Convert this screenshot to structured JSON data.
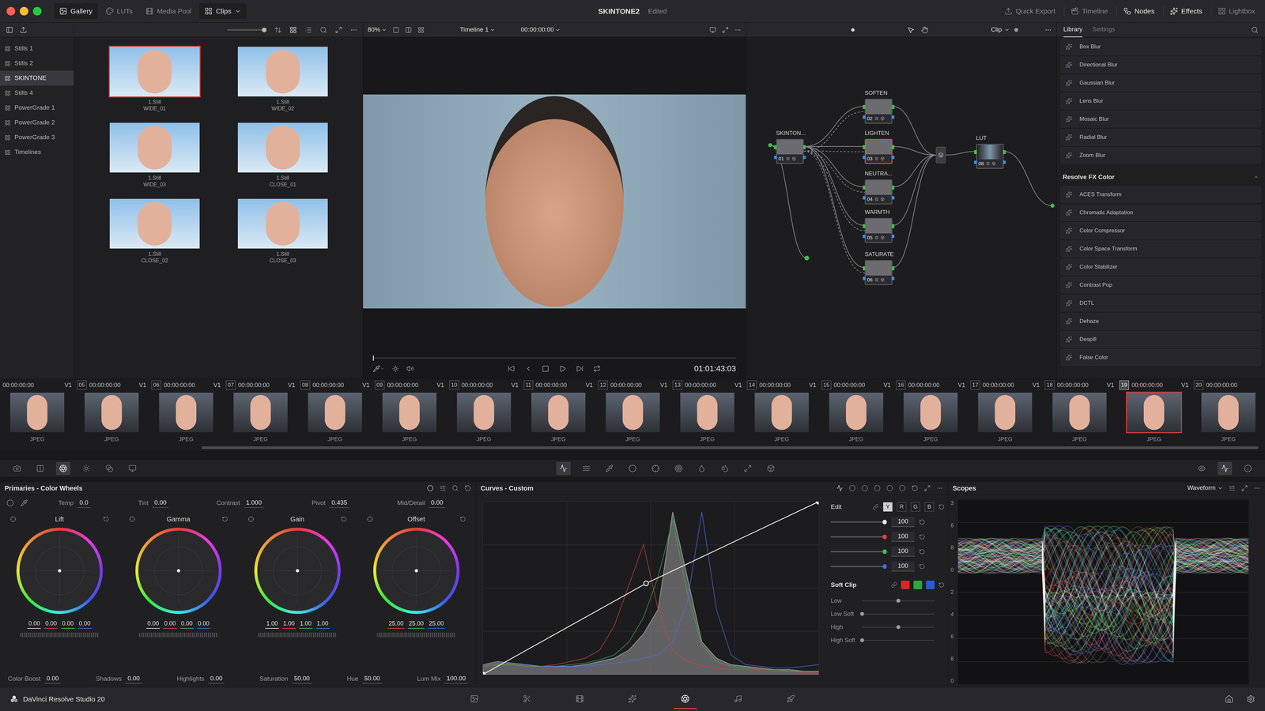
{
  "window": {
    "title": "SKINTONE2",
    "status": "Edited"
  },
  "top_left_tabs": [
    {
      "label": "Gallery",
      "selected": true
    },
    {
      "label": "LUTs",
      "selected": false
    },
    {
      "label": "Media Pool",
      "selected": false
    },
    {
      "label": "Clips",
      "selected": true
    }
  ],
  "top_right_tabs": [
    {
      "label": "Quick Export",
      "selected": false
    },
    {
      "label": "Timeline",
      "selected": false
    },
    {
      "label": "Nodes",
      "selected": true
    },
    {
      "label": "Effects",
      "selected": true
    },
    {
      "label": "Lightbox",
      "selected": false
    }
  ],
  "albums": [
    {
      "label": "Stills 1",
      "selected": false
    },
    {
      "label": "Stills 2",
      "selected": false
    },
    {
      "label": "SKINTONE",
      "selected": true
    },
    {
      "label": "Stills 4",
      "selected": false
    },
    {
      "label": "PowerGrade 1",
      "selected": false
    },
    {
      "label": "PowerGrade 2",
      "selected": false
    },
    {
      "label": "PowerGrade 3",
      "selected": false
    },
    {
      "label": "Timelines",
      "selected": false
    }
  ],
  "stills": [
    {
      "number": "1.Still",
      "name": "WIDE_01",
      "selected": true
    },
    {
      "number": "1.Still",
      "name": "WIDE_02",
      "selected": false
    },
    {
      "number": "1.Still",
      "name": "WIDE_03",
      "selected": false
    },
    {
      "number": "1.Still",
      "name": "CLOSE_01",
      "selected": false
    },
    {
      "number": "1.Still",
      "name": "CLOSE_02",
      "selected": false
    },
    {
      "number": "1.Still",
      "name": "CLOSE_03",
      "selected": false
    }
  ],
  "viewer": {
    "zoom": "80%",
    "timeline": "Timeline 1",
    "timecode": "00:00:00:00",
    "playhead": "01:01:43:03",
    "position": 0.0
  },
  "node_editor": {
    "mode": "Clip",
    "nodes": [
      {
        "label": "SKINTON...",
        "number": "01",
        "selected": false
      },
      {
        "label": "SOFTEN",
        "number": "02",
        "selected": false
      },
      {
        "label": "LIGHTEN",
        "number": "03",
        "selected": true
      },
      {
        "label": "NEUTRA...",
        "number": "04",
        "selected": false
      },
      {
        "label": "WARMTH",
        "number": "05",
        "selected": false
      },
      {
        "label": "SATURATE",
        "number": "06",
        "selected": false
      },
      {
        "label": "LUT",
        "number": "08",
        "selected": false
      }
    ]
  },
  "library": {
    "tabs": [
      {
        "label": "Library",
        "selected": true
      },
      {
        "label": "Settings",
        "selected": false
      }
    ],
    "items": [
      "Box Blur",
      "Directional Blur",
      "Gaussian Blur",
      "Lens Blur",
      "Mosaic Blur",
      "Radial Blur",
      "Zoom Blur"
    ],
    "section": "Resolve FX Color",
    "section_items": [
      "ACES Transform",
      "Chromatic Adaptation",
      "Color Compressor",
      "Color Space Transform",
      "Color Stabilizer",
      "Contrast Pop",
      "DCTL",
      "Dehaze",
      "Despill",
      "False Color"
    ]
  },
  "clips": [
    {
      "timecode": "00:00:00:00",
      "track": "V1",
      "format": "JPEG",
      "selected": false
    },
    {
      "badge": "05",
      "timecode": "00:00:00:00",
      "track": "V1",
      "format": "JPEG",
      "selected": false
    },
    {
      "badge": "06",
      "timecode": "00:00:00:00",
      "track": "V1",
      "format": "JPEG",
      "selected": false
    },
    {
      "badge": "07",
      "timecode": "00:00:00:00",
      "track": "V1",
      "format": "JPEG",
      "selected": false
    },
    {
      "badge": "08",
      "timecode": "00:00:00:00",
      "track": "V1",
      "format": "JPEG",
      "selected": false
    },
    {
      "badge": "09",
      "timecode": "00:00:00:00",
      "track": "V1",
      "format": "JPEG",
      "selected": false
    },
    {
      "badge": "10",
      "timecode": "00:00:00:00",
      "track": "V1",
      "format": "JPEG",
      "selected": false
    },
    {
      "badge": "11",
      "timecode": "00:00:00:00",
      "track": "V1",
      "format": "JPEG",
      "selected": false
    },
    {
      "badge": "12",
      "timecode": "00:00:00:00",
      "track": "V1",
      "format": "JPEG",
      "selected": false
    },
    {
      "badge": "13",
      "timecode": "00:00:00:00",
      "track": "V1",
      "format": "JPEG",
      "selected": false
    },
    {
      "badge": "14",
      "timecode": "00:00:00:00",
      "track": "V1",
      "format": "JPEG",
      "selected": false
    },
    {
      "badge": "15",
      "timecode": "00:00:00:00",
      "track": "V1",
      "format": "JPEG",
      "selected": false
    },
    {
      "badge": "16",
      "timecode": "00:00:00:00",
      "track": "V1",
      "format": "JPEG",
      "selected": false
    },
    {
      "badge": "17",
      "timecode": "00:00:00:00",
      "track": "V1",
      "format": "JPEG",
      "selected": false
    },
    {
      "badge": "18",
      "timecode": "00:00:00:00",
      "track": "V1",
      "format": "JPEG",
      "selected": false
    },
    {
      "badge": "19",
      "timecode": "00:00:00:00",
      "track": "V1",
      "format": "JPEG",
      "selected": true
    },
    {
      "badge": "20",
      "timecode": "00:00:00:00",
      "format": "JPEG",
      "selected": false
    }
  ],
  "palette_tools": {
    "left": [
      {
        "kind": "camera-raw",
        "selected": false
      },
      {
        "kind": "color-match",
        "selected": false
      },
      {
        "kind": "primaries",
        "selected": true
      },
      {
        "kind": "hdr",
        "selected": false
      },
      {
        "kind": "rgb-mixer",
        "selected": false
      },
      {
        "kind": "motion-effects",
        "selected": false
      }
    ],
    "center": [
      {
        "kind": "curves",
        "selected": true
      },
      {
        "kind": "warper",
        "selected": false
      },
      {
        "kind": "qualifier",
        "selected": false
      },
      {
        "kind": "window",
        "selected": false
      },
      {
        "kind": "tracker",
        "selected": false
      },
      {
        "kind": "magic-mask",
        "selected": false
      },
      {
        "kind": "blur",
        "selected": false
      },
      {
        "kind": "key",
        "selected": false
      },
      {
        "kind": "sizing",
        "selected": false
      },
      {
        "kind": "3d",
        "selected": false
      }
    ],
    "right": [
      {
        "kind": "gallery-view",
        "selected": false
      },
      {
        "kind": "scopes",
        "selected": true
      },
      {
        "kind": "info",
        "selected": false
      }
    ]
  },
  "primaries": {
    "title": "Primaries - Color Wheels",
    "params": [
      {
        "label": "Temp",
        "value": "0.0"
      },
      {
        "label": "Tint",
        "value": "0.00"
      },
      {
        "label": "Contrast",
        "value": "1.000"
      },
      {
        "label": "Pivot",
        "value": "0.435"
      },
      {
        "label": "Mid/Detail",
        "value": "0.00"
      }
    ],
    "wheels": [
      {
        "label": "Lift",
        "values": [
          {
            "value": "0.00",
            "color": "#d8d8d8"
          },
          {
            "value": "0.00",
            "color": "#e0403a"
          },
          {
            "value": "0.00",
            "color": "#3fbf4a"
          },
          {
            "value": "0.00",
            "color": "#3a6fe0"
          }
        ]
      },
      {
        "label": "Gamma",
        "values": [
          {
            "value": "0.00",
            "color": "#d8d8d8"
          },
          {
            "value": "0.00",
            "color": "#e0403a"
          },
          {
            "value": "0.00",
            "color": "#3fbf4a"
          },
          {
            "value": "0.00",
            "color": "#3a6fe0"
          }
        ]
      },
      {
        "label": "Gain",
        "values": [
          {
            "value": "1.00",
            "color": "#d8d8d8"
          },
          {
            "value": "1.00",
            "color": "#e0403a"
          },
          {
            "value": "1.00",
            "color": "#3fbf4a"
          },
          {
            "value": "1.00",
            "color": "#3a6fe0"
          }
        ]
      },
      {
        "label": "Offset",
        "values": [
          {
            "value": "25.00",
            "color": "#e0403a"
          },
          {
            "value": "25.00",
            "color": "#3fbf4a"
          },
          {
            "value": "25.00",
            "color": "#3a6fe0"
          }
        ]
      }
    ],
    "bottom_params": [
      {
        "label": "Color Boost",
        "value": "0.00"
      },
      {
        "label": "Shadows",
        "value": "0.00"
      },
      {
        "label": "Highlights",
        "value": "0.00"
      },
      {
        "label": "Saturation",
        "value": "50.00"
      },
      {
        "label": "Hue",
        "value": "50.00"
      },
      {
        "label": "Lum Mix",
        "value": "100.00"
      }
    ]
  },
  "curves": {
    "title": "Curves - Custom",
    "edit_label": "Edit",
    "channels": [
      {
        "label": "Y",
        "selected": true
      },
      {
        "label": "R",
        "selected": false
      },
      {
        "label": "G",
        "selected": false
      },
      {
        "label": "B",
        "selected": false
      }
    ],
    "intensity": [
      {
        "value": "100",
        "color": "#e6e6e6",
        "level": 1
      },
      {
        "value": "100",
        "color": "#e0403a",
        "level": 1
      },
      {
        "value": "100",
        "color": "#3fbf4a",
        "level": 1
      },
      {
        "value": "100",
        "color": "#3a6fe0",
        "level": 1
      }
    ],
    "soft_clip": {
      "label": "Soft Clip",
      "channels": [
        {
          "color": "#d8262a",
          "on": true
        },
        {
          "color": "#2aa83a",
          "on": true
        },
        {
          "color": "#2a5ad8",
          "on": true
        }
      ],
      "rows": [
        {
          "label": "Low",
          "level": 0.5
        },
        {
          "label": "Low Soft",
          "level": 0
        },
        {
          "label": "High",
          "level": 0.5
        },
        {
          "label": "High Soft",
          "level": 0
        }
      ]
    },
    "curve_points": [
      [
        0,
        0
      ],
      [
        0.486,
        0.527
      ],
      [
        1,
        1
      ]
    ],
    "histogram": [
      {
        "name": "luma",
        "color": "#9a9a9a",
        "values": [
          0.06,
          0.08,
          0.07,
          0.06,
          0.05,
          0.05,
          0.05,
          0.06,
          0.08,
          0.1,
          0.15,
          0.25,
          0.4,
          1.0,
          0.6,
          0.2,
          0.1,
          0.06,
          0.05,
          0.04,
          0.03,
          0.03,
          0.02,
          0.02
        ]
      },
      {
        "name": "red",
        "color": "#d8403a",
        "values": [
          0.05,
          0.07,
          0.06,
          0.05,
          0.05,
          0.06,
          0.08,
          0.1,
          0.15,
          0.3,
          0.55,
          0.8,
          0.4,
          0.15,
          0.08,
          0.05,
          0.04,
          0.03,
          0.03,
          0.02,
          0.02,
          0.02,
          0.01,
          0.01
        ]
      },
      {
        "name": "green",
        "color": "#3fae4a",
        "values": [
          0.05,
          0.06,
          0.06,
          0.05,
          0.05,
          0.05,
          0.06,
          0.07,
          0.09,
          0.12,
          0.2,
          0.35,
          0.6,
          0.95,
          0.5,
          0.18,
          0.08,
          0.05,
          0.04,
          0.03,
          0.03,
          0.02,
          0.02,
          0.02
        ]
      },
      {
        "name": "blue",
        "color": "#4a70e0",
        "values": [
          0.06,
          0.08,
          0.07,
          0.06,
          0.05,
          0.05,
          0.05,
          0.05,
          0.06,
          0.07,
          0.08,
          0.1,
          0.12,
          0.2,
          0.45,
          1.0,
          0.4,
          0.12,
          0.06,
          0.05,
          0.04,
          0.04,
          0.05,
          0.06
        ]
      }
    ]
  },
  "scopes": {
    "title": "Scopes",
    "mode": "Waveform",
    "scale": [
      "3",
      "6",
      "8",
      "0",
      "2",
      "4",
      "6",
      "8",
      "0"
    ]
  },
  "footer": {
    "app": "DaVinci Resolve Studio 20",
    "pages": [
      {
        "kind": "media",
        "selected": false
      },
      {
        "kind": "cut",
        "selected": false
      },
      {
        "kind": "edit",
        "selected": false
      },
      {
        "kind": "fusion",
        "selected": false
      },
      {
        "kind": "color",
        "selected": true
      },
      {
        "kind": "fairlight",
        "selected": false
      },
      {
        "kind": "deliver",
        "selected": false
      }
    ]
  }
}
